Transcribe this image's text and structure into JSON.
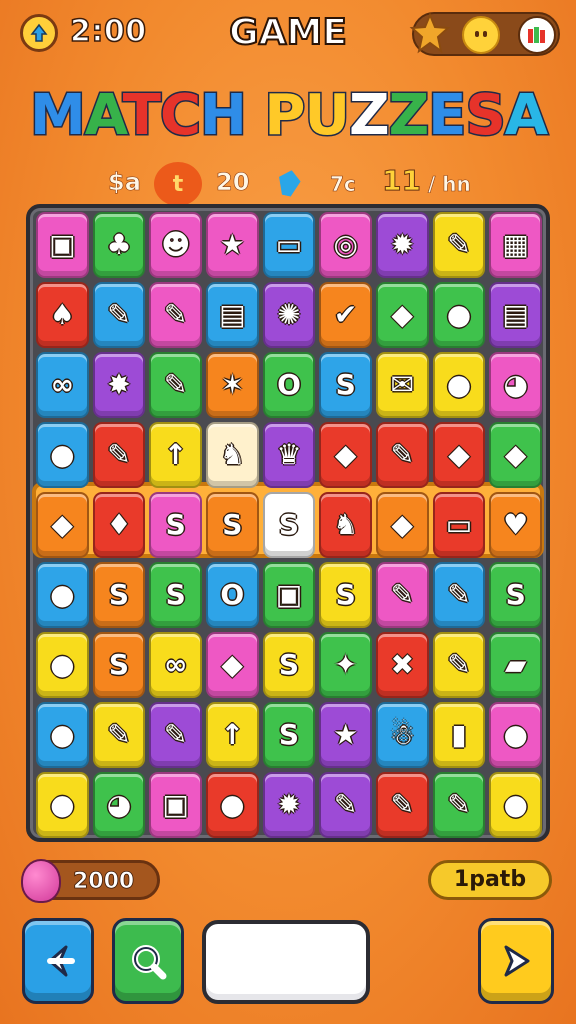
{
  "header": {
    "timer": "2:00",
    "title": "GAME",
    "icons": [
      "timer-icon",
      "puzzle-star-icon",
      "face-icon",
      "gift-icon"
    ]
  },
  "logo": {
    "text": "MATCH PUZZESA",
    "letters": [
      {
        "ch": "M",
        "color": "#2f8de8"
      },
      {
        "ch": "A",
        "color": "#37b24a"
      },
      {
        "ch": "T",
        "color": "#e6332a"
      },
      {
        "ch": "C",
        "color": "#e6332a"
      },
      {
        "ch": "H",
        "color": "#2f8de8"
      },
      {
        "ch": " ",
        "color": "#ffffff"
      },
      {
        "ch": "P",
        "color": "#ffc928"
      },
      {
        "ch": "U",
        "color": "#ffc928"
      },
      {
        "ch": "Z",
        "color": "#ffffff"
      },
      {
        "ch": "Z",
        "color": "#37b24a"
      },
      {
        "ch": "E",
        "color": "#2f8de8"
      },
      {
        "ch": "S",
        "color": "#e6332a"
      },
      {
        "ch": "A",
        "color": "#29b6e6"
      }
    ]
  },
  "stats": {
    "a": "$a",
    "flame": "t",
    "count": "20",
    "gem_label": "7c",
    "level": "11",
    "suffix": "/ hn"
  },
  "colors": {
    "pink": "#ee58c4",
    "green": "#3fc24c",
    "blue": "#2ea4e8",
    "orange": "#f6851e",
    "purple": "#9d4bd6",
    "yellow": "#f8dc1c",
    "red": "#e93a2a",
    "white": "#ffffff",
    "cream": "#fff1cc"
  },
  "board": {
    "rows": [
      [
        [
          "pink",
          "▣"
        ],
        [
          "green",
          "♣"
        ],
        [
          "pink",
          "☻"
        ],
        [
          "pink",
          "★"
        ],
        [
          "blue",
          "▭"
        ],
        [
          "pink",
          "◎"
        ],
        [
          "purple",
          "✹"
        ],
        [
          "yellow",
          "✎"
        ],
        [
          "pink",
          "▦"
        ]
      ],
      [
        [
          "red",
          "♠"
        ],
        [
          "blue",
          "✎"
        ],
        [
          "pink",
          "✎"
        ],
        [
          "blue",
          "▤"
        ],
        [
          "purple",
          "✺"
        ],
        [
          "orange",
          "✔"
        ],
        [
          "green",
          "◆"
        ],
        [
          "green",
          "●"
        ],
        [
          "purple",
          "▤"
        ]
      ],
      [
        [
          "blue",
          "∞"
        ],
        [
          "purple",
          "✸"
        ],
        [
          "green",
          "✎"
        ],
        [
          "orange",
          "✶"
        ],
        [
          "green",
          "O"
        ],
        [
          "blue",
          "S"
        ],
        [
          "yellow",
          "✉"
        ],
        [
          "yellow",
          "●"
        ],
        [
          "pink",
          "◕"
        ]
      ],
      [
        [
          "blue",
          "●"
        ],
        [
          "red",
          "✎"
        ],
        [
          "yellow",
          "↑"
        ],
        [
          "cream",
          "♞"
        ],
        [
          "purple",
          "♛"
        ],
        [
          "red",
          "◆"
        ],
        [
          "red",
          "✎"
        ],
        [
          "red",
          "◆"
        ],
        [
          "green",
          "◆"
        ]
      ],
      [
        [
          "orange",
          "◆"
        ],
        [
          "red",
          "♦"
        ],
        [
          "pink",
          "S"
        ],
        [
          "orange",
          "S"
        ],
        [
          "white",
          "S"
        ],
        [
          "red",
          "♞"
        ],
        [
          "orange",
          "◆"
        ],
        [
          "red",
          "▭"
        ],
        [
          "orange",
          "♥"
        ]
      ],
      [
        [
          "blue",
          "●"
        ],
        [
          "orange",
          "S"
        ],
        [
          "green",
          "S"
        ],
        [
          "blue",
          "O"
        ],
        [
          "green",
          "▣"
        ],
        [
          "yellow",
          "S"
        ],
        [
          "pink",
          "✎"
        ],
        [
          "blue",
          "✎"
        ],
        [
          "green",
          "S"
        ]
      ],
      [
        [
          "yellow",
          "●"
        ],
        [
          "orange",
          "S"
        ],
        [
          "yellow",
          "∞"
        ],
        [
          "pink",
          "◆"
        ],
        [
          "yellow",
          "S"
        ],
        [
          "green",
          "✦"
        ],
        [
          "red",
          "✖"
        ],
        [
          "yellow",
          "✎"
        ],
        [
          "green",
          "▰"
        ]
      ],
      [
        [
          "blue",
          "●"
        ],
        [
          "yellow",
          "✎"
        ],
        [
          "purple",
          "✎"
        ],
        [
          "yellow",
          "↑"
        ],
        [
          "green",
          "S"
        ],
        [
          "purple",
          "★"
        ],
        [
          "blue",
          "☃"
        ],
        [
          "yellow",
          "▮"
        ],
        [
          "pink",
          "●"
        ]
      ],
      [
        [
          "yellow",
          "●"
        ],
        [
          "green",
          "◕"
        ],
        [
          "pink",
          "▣"
        ],
        [
          "red",
          "●"
        ],
        [
          "purple",
          "✹"
        ],
        [
          "purple",
          "✎"
        ],
        [
          "red",
          "✎"
        ],
        [
          "green",
          "✎"
        ],
        [
          "yellow",
          "●"
        ]
      ]
    ]
  },
  "footer": {
    "score": "2000",
    "right_label": "1patb",
    "buttons": [
      "back-button",
      "search-button",
      "next-button"
    ]
  }
}
